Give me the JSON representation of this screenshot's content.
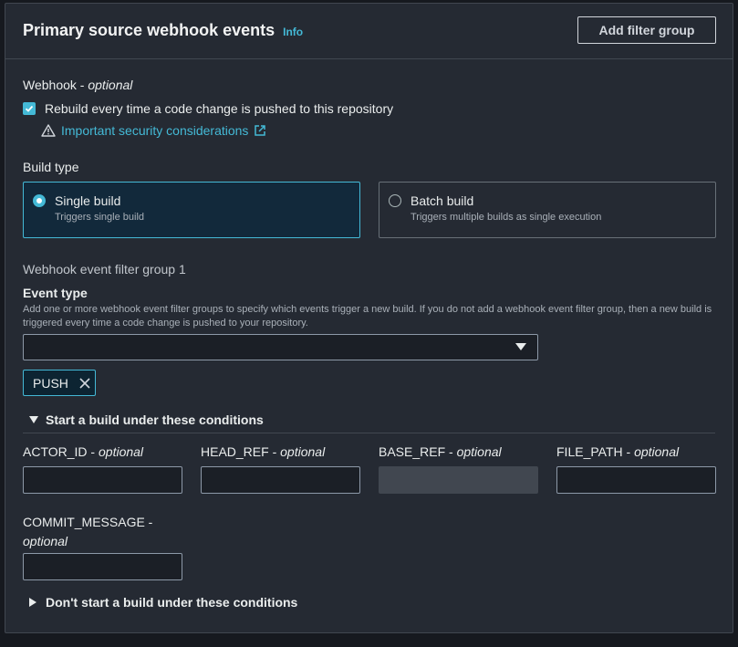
{
  "header": {
    "title": "Primary source webhook events",
    "info": "Info",
    "add_filter_group": "Add filter group"
  },
  "webhook": {
    "label": "Webhook",
    "label_suffix": "optional",
    "rebuild_checkbox": {
      "label": "Rebuild every time a code change is pushed to this repository",
      "checked": true
    },
    "security_link": "Important security considerations"
  },
  "build_type": {
    "label": "Build type",
    "options": [
      {
        "title": "Single build",
        "description": "Triggers single build",
        "selected": true
      },
      {
        "title": "Batch build",
        "description": "Triggers multiple builds as single execution",
        "selected": false
      }
    ]
  },
  "filter_group": {
    "title": "Webhook event filter group 1",
    "event_type_label": "Event type",
    "event_type_description": "Add one or more webhook event filter groups to specify which events trigger a new build. If you do not add a webhook event filter group, then a new build is triggered every time a code change is pushed to your repository.",
    "event_type_value": "",
    "tokens": [
      "PUSH"
    ]
  },
  "start_conditions": {
    "label": "Start a build under these conditions",
    "expanded": true,
    "fields": [
      {
        "name": "ACTOR_ID",
        "suffix": "optional",
        "value": "",
        "disabled": false
      },
      {
        "name": "HEAD_REF",
        "suffix": "optional",
        "value": "",
        "disabled": false
      },
      {
        "name": "BASE_REF",
        "suffix": "optional",
        "value": "",
        "disabled": true
      },
      {
        "name": "FILE_PATH",
        "suffix": "optional",
        "value": "",
        "disabled": false
      },
      {
        "name": "COMMIT_MESSAGE -",
        "suffix": "optional",
        "value": "",
        "disabled": false
      }
    ]
  },
  "dont_start_conditions": {
    "label": "Don't start a build under these conditions",
    "expanded": false
  },
  "colors": {
    "accent": "#44b9d6",
    "panel": "#252a33",
    "border": "#414750",
    "text": "#eaeded"
  }
}
